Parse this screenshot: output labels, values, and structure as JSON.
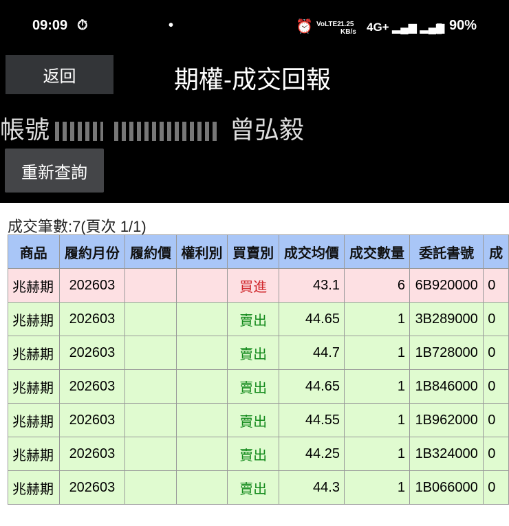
{
  "status": {
    "time": "09:09",
    "net_speed": "1.25 KB/s",
    "network": "4G+",
    "volte": "VoLTE2",
    "battery": "90%"
  },
  "header": {
    "back_label": "返回",
    "title": "期權-成交回報",
    "account_label": "帳號",
    "account_name": "曾弘毅",
    "requery_label": "重新查詢"
  },
  "summary": "成交筆數:7(頁次 1/1)",
  "table": {
    "headers": [
      "商品",
      "履約月份",
      "履約價",
      "權利別",
      "買賣別",
      "成交均價",
      "成交數量",
      "委託書號",
      "成"
    ],
    "rows": [
      {
        "type": "buy",
        "cells": [
          "兆赫期",
          "202603",
          "",
          "",
          "買進",
          "43.1",
          "6",
          "6B920000",
          "0"
        ]
      },
      {
        "type": "sell",
        "cells": [
          "兆赫期",
          "202603",
          "",
          "",
          "賣出",
          "44.65",
          "1",
          "3B289000",
          "0"
        ]
      },
      {
        "type": "sell",
        "cells": [
          "兆赫期",
          "202603",
          "",
          "",
          "賣出",
          "44.7",
          "1",
          "1B728000",
          "0"
        ]
      },
      {
        "type": "sell",
        "cells": [
          "兆赫期",
          "202603",
          "",
          "",
          "賣出",
          "44.65",
          "1",
          "1B846000",
          "0"
        ]
      },
      {
        "type": "sell",
        "cells": [
          "兆赫期",
          "202603",
          "",
          "",
          "賣出",
          "44.55",
          "1",
          "1B962000",
          "0"
        ]
      },
      {
        "type": "sell",
        "cells": [
          "兆赫期",
          "202603",
          "",
          "",
          "賣出",
          "44.25",
          "1",
          "1B324000",
          "0"
        ]
      },
      {
        "type": "sell",
        "cells": [
          "兆赫期",
          "202603",
          "",
          "",
          "賣出",
          "44.3",
          "1",
          "1B066000",
          "0"
        ]
      }
    ]
  },
  "colors": {
    "header_bg": "#a9c6f7",
    "buy_bg": "#fde0e3",
    "sell_bg": "#e0fbd0",
    "buy_text": "#d0262b",
    "sell_text": "#138a1c"
  }
}
